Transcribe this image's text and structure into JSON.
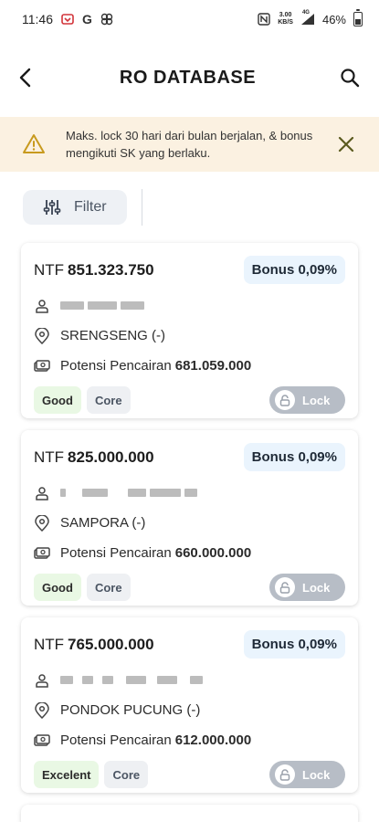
{
  "status_bar": {
    "time": "11:46",
    "speed_value": "3.00",
    "speed_unit": "KB/S",
    "network": "4G",
    "battery": "46%"
  },
  "header": {
    "title": "RO DATABASE",
    "back_icon": "arrow-left-icon",
    "search_icon": "search-icon"
  },
  "notice": {
    "text": "Maks. lock 30 hari dari bulan berjalan, & bonus mengikuti SK yang berlaku.",
    "warning_icon": "warning-icon",
    "close_icon": "close-icon"
  },
  "filter": {
    "label": "Filter",
    "icon": "sliders-icon"
  },
  "cards": [
    {
      "ntf_label": "NTF",
      "ntf_amount": "851.323.750",
      "bonus": "Bonus 0,09%",
      "location": "SRENGSENG (-)",
      "potensi_label": "Potensi Pencairan",
      "potensi_amount": "681.059.000",
      "tag_status": "Good",
      "tag_type": "Core",
      "lock_label": "Lock"
    },
    {
      "ntf_label": "NTF",
      "ntf_amount": "825.000.000",
      "bonus": "Bonus 0,09%",
      "location": "SAMPORA (-)",
      "potensi_label": "Potensi Pencairan",
      "potensi_amount": "660.000.000",
      "tag_status": "Good",
      "tag_type": "Core",
      "lock_label": "Lock"
    },
    {
      "ntf_label": "NTF",
      "ntf_amount": "765.000.000",
      "bonus": "Bonus 0,09%",
      "location": "PONDOK PUCUNG (-)",
      "potensi_label": "Potensi Pencairan",
      "potensi_amount": "612.000.000",
      "tag_status": "Excelent",
      "tag_type": "Core",
      "lock_label": "Lock"
    }
  ],
  "colors": {
    "notice_bg": "#fbf1e1",
    "warning": "#c89a1e",
    "bonus_bg": "#eaf4fd",
    "good_bg": "#e9f8e4",
    "lock_bg": "#b7bdc6"
  }
}
